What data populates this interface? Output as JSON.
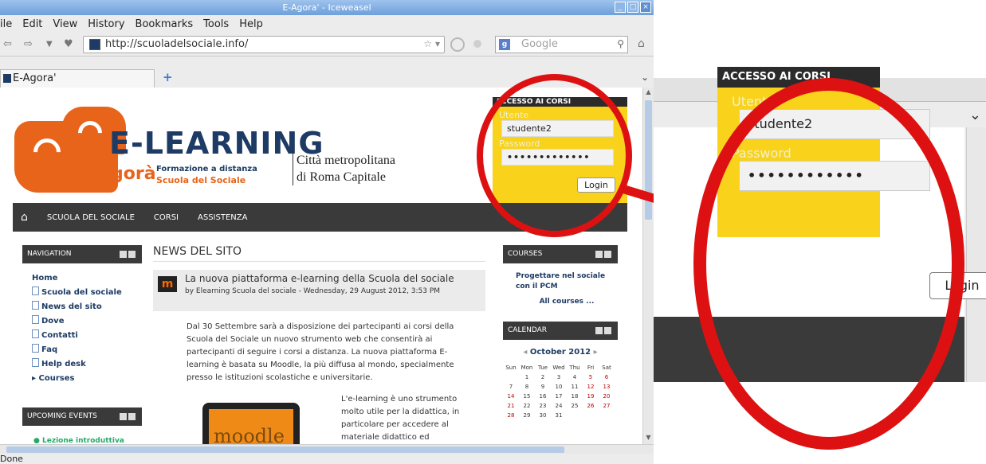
{
  "window": {
    "title": "E-Agora' - Iceweasel",
    "controls": [
      "_",
      "□",
      "×"
    ]
  },
  "menu": [
    "ile",
    "Edit",
    "View",
    "History",
    "Bookmarks",
    "Tools",
    "Help"
  ],
  "address": {
    "url": "http://scuoladelsociale.info/",
    "search_placeholder": "Google"
  },
  "tabs": [
    {
      "label": "E-Agora'"
    }
  ],
  "status": "Done",
  "site": {
    "logo": {
      "line1": "E-LEARNING",
      "line2": "Agorà",
      "tag1": "Formazione a distanza",
      "tag2": "Scuola del Sociale",
      "city1": "Città metropolitana",
      "city2": "di Roma Capitale"
    },
    "login": {
      "header": "ACCESSO AI CORSI",
      "user_label": "Utente",
      "user_value": "studente2",
      "password_label": "Password",
      "password_value": "•••••••••••••",
      "button": "Login"
    },
    "topnav": [
      "SCUOLA DEL SOCIALE",
      "CORSI",
      "ASSISTENZA"
    ],
    "navigation": {
      "header": "NAVIGATION",
      "items": [
        "Home",
        "Scuola del sociale",
        "News del sito",
        "Dove",
        "Contatti",
        "Faq",
        "Help desk",
        "Courses"
      ]
    },
    "upcoming": {
      "header": "UPCOMING EVENTS",
      "item": "Lezione introduttiva"
    },
    "news": {
      "header": "NEWS DEL SITO",
      "post_title": "La nuova piattaforma e-learning della Scuola del sociale",
      "post_by": "by Elearning Scuola del sociale - Wednesday, 29 August 2012, 3:53 PM",
      "body1": "Dal 30 Settembre sarà a disposizione dei partecipanti ai corsi della Scuola del Sociale un nuovo strumento web che consentirà ai partecipanti di seguire i corsi a distanza. La nuova piattaforma E-learning è basata su Moodle, la più diffusa al mondo, specialmente presso le istituzioni scolastiche e universitarie.",
      "body2": "L'e-learning è uno strumento molto utile per la didattica, in particolare per accedere al materiale didattico ed",
      "image_text": "moodle"
    },
    "courses": {
      "header": "COURSES",
      "item": "Progettare nel sociale con il PCM",
      "all": "All courses ..."
    },
    "calendar": {
      "header": "CALENDAR",
      "month": "October 2012",
      "days": [
        "Sun",
        "Mon",
        "Tue",
        "Wed",
        "Thu",
        "Fri",
        "Sat"
      ],
      "weeks": [
        [
          "",
          "1",
          "2",
          "3",
          "4",
          "5",
          "6"
        ],
        [
          "7",
          "8",
          "9",
          "10",
          "11",
          "12",
          "13"
        ],
        [
          "14",
          "15",
          "16",
          "17",
          "18",
          "19",
          "20"
        ],
        [
          "21",
          "22",
          "23",
          "24",
          "25",
          "26",
          "27"
        ],
        [
          "28",
          "29",
          "30",
          "31",
          "",
          "",
          ""
        ]
      ]
    }
  },
  "zoom": {
    "header": "ACCESSO AI CORSI",
    "user_label": "Utente",
    "user_value": "studente2",
    "password_label": "Password",
    "password_value": "••••••••••••",
    "button": "Login"
  }
}
